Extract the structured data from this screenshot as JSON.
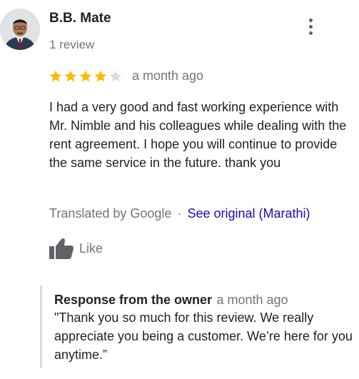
{
  "author": {
    "name": "B.B. Mate",
    "review_count": "1 review"
  },
  "rating": {
    "value": 4,
    "max": 5,
    "filled_color": "#fbbc04",
    "empty_color": "#dadce0"
  },
  "date": "a month ago",
  "review_text": "I had a very good and fast working experience with Mr. Nimble and his colleagues while dealing with the rent agreement. I hope you will continue to provide the same service in the future. thank you",
  "translation": {
    "label": "Translated by Google",
    "separator": "·",
    "see_original": "See original (Marathi)"
  },
  "like_label": "Like",
  "owner_response": {
    "label": "Response from the owner",
    "date": "a month ago",
    "text": "\"Thank you so much for this review. We really appreciate you being a customer. We’re here for you anytime.”"
  },
  "icons": {
    "more": "more-vert-icon",
    "like": "thumbs-up-icon",
    "star": "star-icon"
  }
}
